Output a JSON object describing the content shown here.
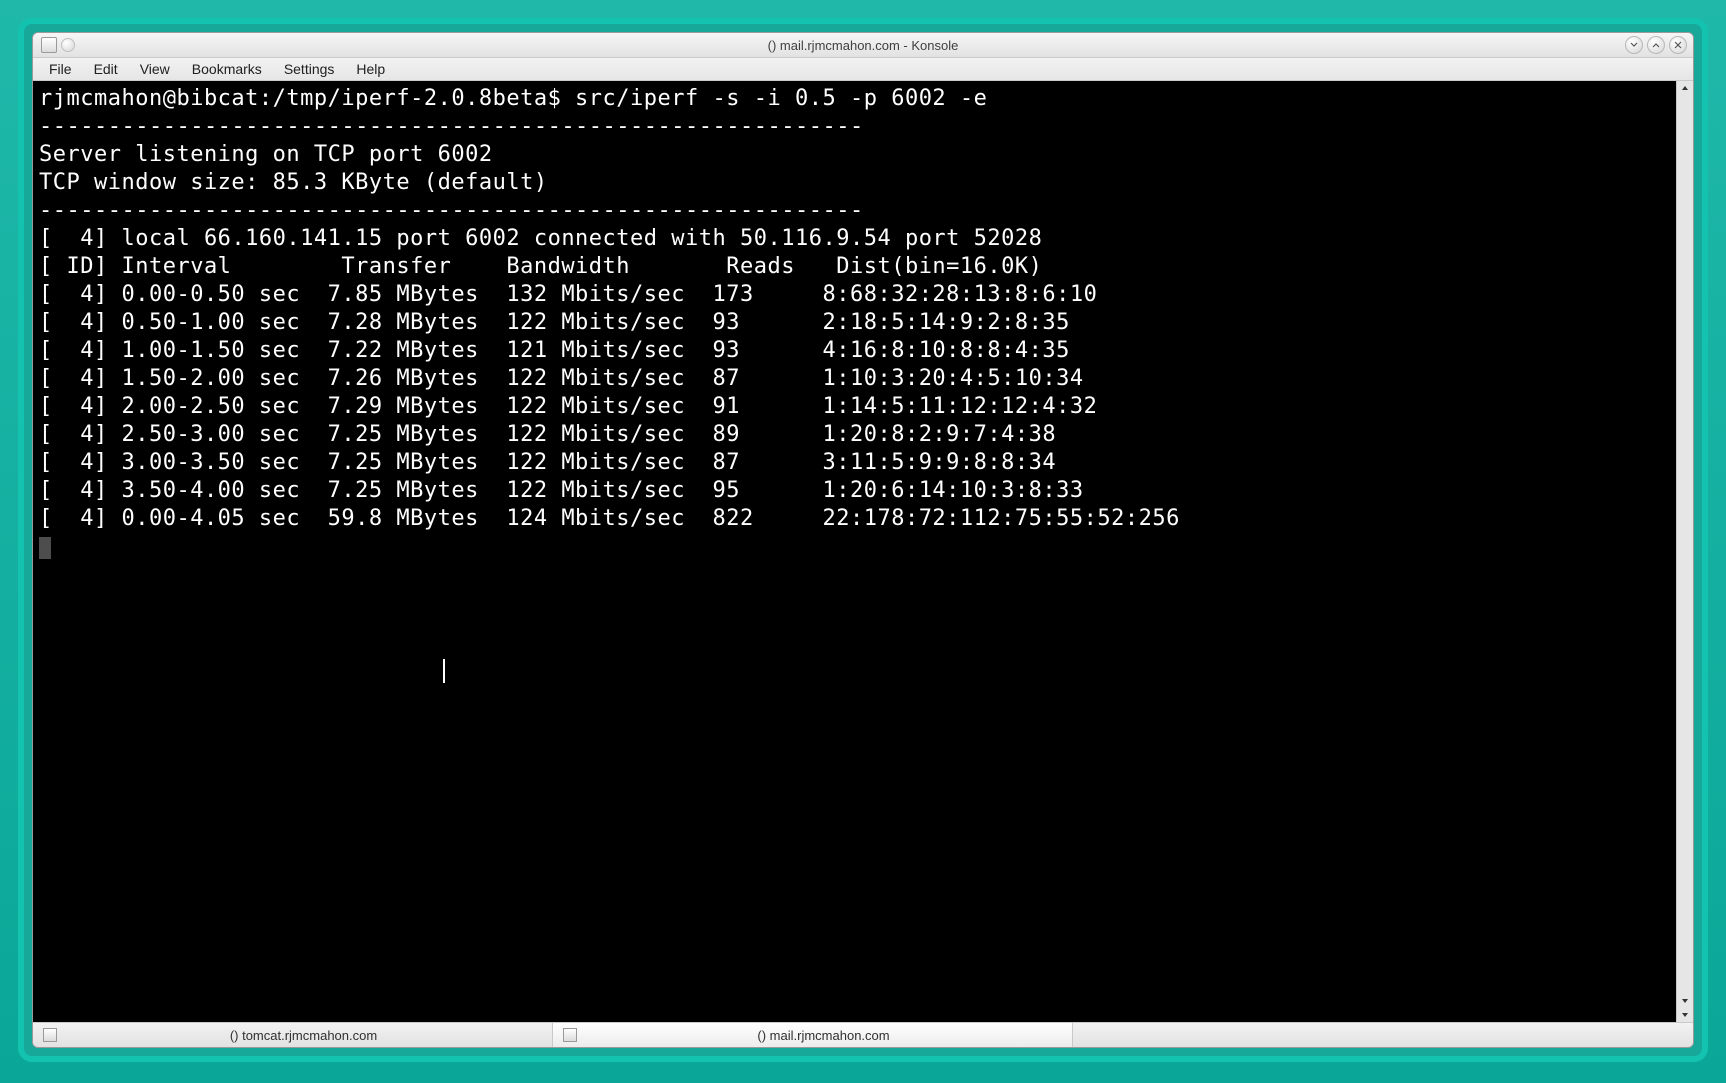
{
  "window": {
    "title": "() mail.rjmcmahon.com - Konsole"
  },
  "menubar": [
    "File",
    "Edit",
    "View",
    "Bookmarks",
    "Settings",
    "Help"
  ],
  "terminal": {
    "prompt": "rjmcmahon@bibcat:/tmp/iperf-2.0.8beta$",
    "command": "src/iperf -s -i 0.5 -p 6002 -e",
    "divider": "------------------------------------------------------------",
    "serverline": "Server listening on TCP port 6002",
    "windowline": "TCP window size: 85.3 KByte (default)",
    "connline": "[  4] local 66.160.141.15 port 6002 connected with 50.116.9.54 port 52028",
    "header": "[ ID] Interval        Transfer    Bandwidth       Reads   Dist(bin=16.0K)",
    "rows": [
      {
        "id": "4",
        "interval": "0.00-0.50",
        "transfer": "7.85 MBytes",
        "bw": "132 Mbits/sec",
        "reads": "173",
        "dist": "8:68:32:28:13:8:6:10"
      },
      {
        "id": "4",
        "interval": "0.50-1.00",
        "transfer": "7.28 MBytes",
        "bw": "122 Mbits/sec",
        "reads": "93",
        "dist": "2:18:5:14:9:2:8:35"
      },
      {
        "id": "4",
        "interval": "1.00-1.50",
        "transfer": "7.22 MBytes",
        "bw": "121 Mbits/sec",
        "reads": "93",
        "dist": "4:16:8:10:8:8:4:35"
      },
      {
        "id": "4",
        "interval": "1.50-2.00",
        "transfer": "7.26 MBytes",
        "bw": "122 Mbits/sec",
        "reads": "87",
        "dist": "1:10:3:20:4:5:10:34"
      },
      {
        "id": "4",
        "interval": "2.00-2.50",
        "transfer": "7.29 MBytes",
        "bw": "122 Mbits/sec",
        "reads": "91",
        "dist": "1:14:5:11:12:12:4:32"
      },
      {
        "id": "4",
        "interval": "2.50-3.00",
        "transfer": "7.25 MBytes",
        "bw": "122 Mbits/sec",
        "reads": "89",
        "dist": "1:20:8:2:9:7:4:38"
      },
      {
        "id": "4",
        "interval": "3.00-3.50",
        "transfer": "7.25 MBytes",
        "bw": "122 Mbits/sec",
        "reads": "87",
        "dist": "3:11:5:9:9:8:8:34"
      },
      {
        "id": "4",
        "interval": "3.50-4.00",
        "transfer": "7.25 MBytes",
        "bw": "122 Mbits/sec",
        "reads": "95",
        "dist": "1:20:6:14:10:3:8:33"
      },
      {
        "id": "4",
        "interval": "0.00-4.05",
        "transfer": "59.8 MBytes",
        "bw": "124 Mbits/sec",
        "reads": "822",
        "dist": "22:178:72:112:75:55:52:256"
      }
    ]
  },
  "tabs": [
    {
      "label": "() tomcat.rjmcmahon.com",
      "active": false
    },
    {
      "label": "() mail.rjmcmahon.com",
      "active": true
    }
  ]
}
